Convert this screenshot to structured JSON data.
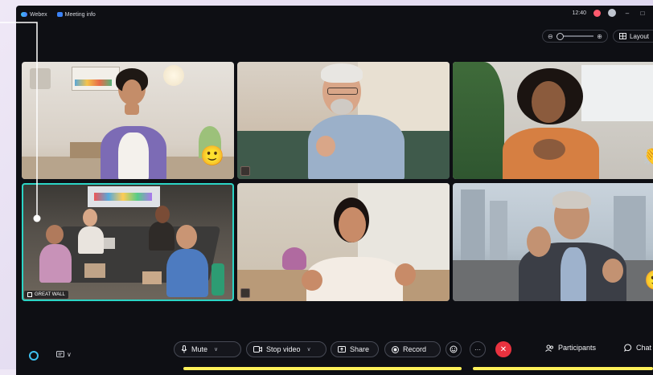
{
  "titlebar": {
    "app_label": "Webex",
    "meeting_info_label": "Meeting info",
    "time": "12:40",
    "minimize_glyph": "–",
    "maximize_glyph": "□"
  },
  "view_controls": {
    "zoom_out_glyph": "⊖",
    "zoom_in_glyph": "⊕",
    "zoom_level": 0.0,
    "layout_label": "Layout",
    "layout_icon": "grid-icon"
  },
  "tiles": [
    {
      "id": "participant-1",
      "reaction": "🙂",
      "reaction_name": "smile-reaction"
    },
    {
      "id": "participant-2"
    },
    {
      "id": "participant-3",
      "reaction": "👏",
      "reaction_name": "clap-reaction"
    },
    {
      "id": "room-great-wall",
      "room_label": "GREAT WALL",
      "active_speaker": true
    },
    {
      "id": "participant-5"
    },
    {
      "id": "participant-6",
      "reaction": "🙂",
      "reaction_name": "smile-reaction"
    }
  ],
  "toolbar": {
    "mute_label": "Mute",
    "stop_video_label": "Stop video",
    "share_label": "Share",
    "record_label": "Record",
    "more_glyph": "···",
    "end_glyph": "✕",
    "participants_label": "Participants",
    "chat_label": "Chat",
    "chevron": "∨"
  },
  "colors": {
    "window_bg": "#0e0f14",
    "active_border": "#2bd4c5",
    "end_call": "#e8323f",
    "record_red": "#ff5a6e",
    "highlight": "#fff15a",
    "accent_blue": "#3ec1f0"
  }
}
